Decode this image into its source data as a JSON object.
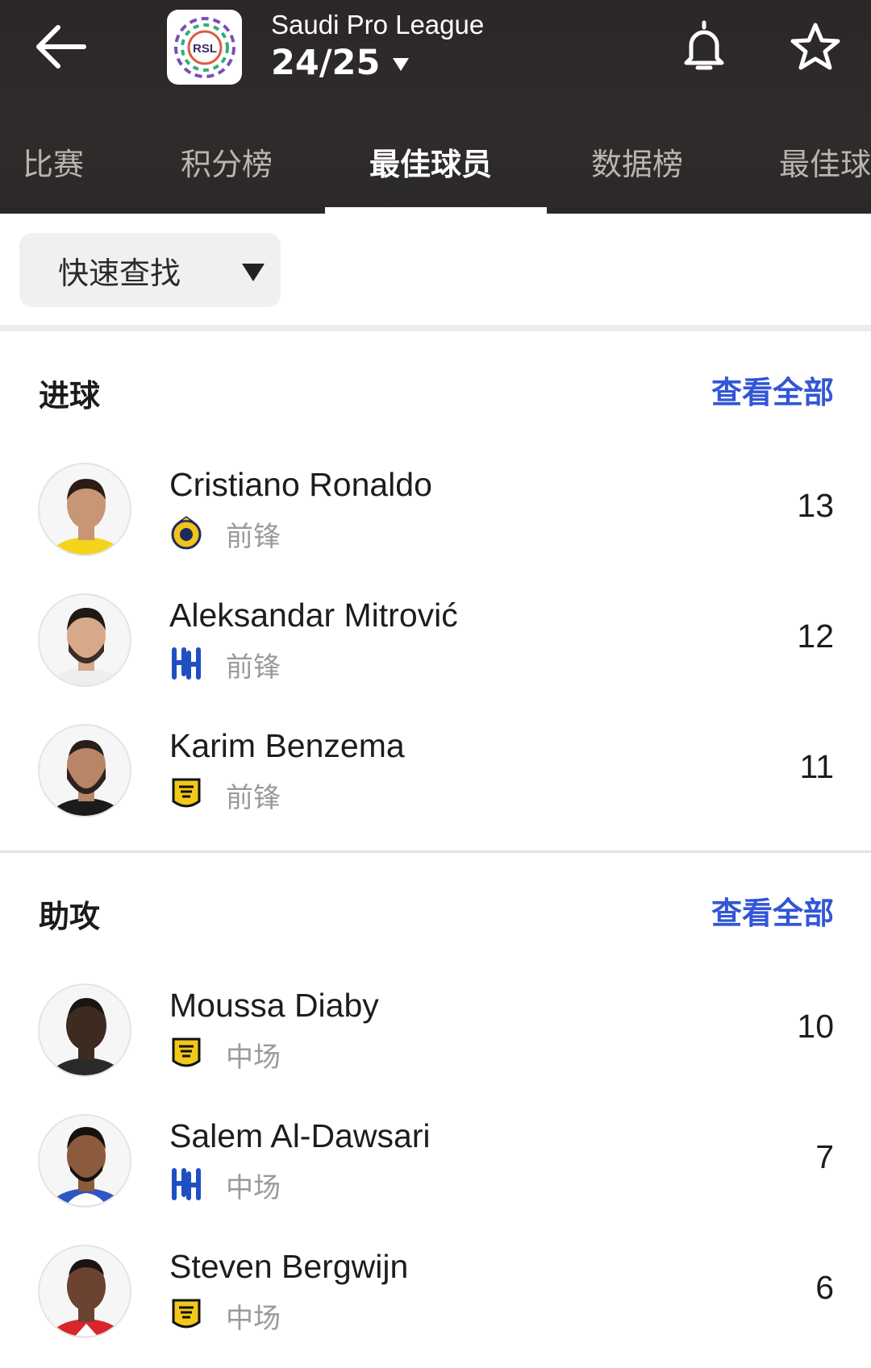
{
  "header": {
    "league_name": "Saudi Pro League",
    "season": "24/25",
    "logo_text": "RSL"
  },
  "tabs": [
    "比赛",
    "积分榜",
    "最佳球员",
    "数据榜",
    "最佳球"
  ],
  "active_tab": "最佳球员",
  "filter": {
    "quick_find_label": "快速查找"
  },
  "sections": [
    {
      "title": "进球",
      "view_all": "查看全部",
      "players": [
        {
          "name": "Cristiano Ronaldo",
          "position": "前锋",
          "value": "13",
          "club_icon": "al-nassr-badge-icon",
          "skin": "#c89674",
          "hair": "#2a1d15",
          "shirt": "#f3d31c"
        },
        {
          "name": "Aleksandar Mitrović",
          "position": "前锋",
          "value": "12",
          "club_icon": "al-hilal-badge-icon",
          "skin": "#d7a98a",
          "hair": "#1e1915",
          "shirt": "#eeeeee"
        },
        {
          "name": "Karim Benzema",
          "position": "前锋",
          "value": "11",
          "club_icon": "al-ittihad-badge-icon",
          "skin": "#b88567",
          "hair": "#262019",
          "shirt": "#1b1b1b"
        }
      ]
    },
    {
      "title": "助攻",
      "view_all": "查看全部",
      "players": [
        {
          "name": "Moussa Diaby",
          "position": "中场",
          "value": "10",
          "club_icon": "al-ittihad-badge-icon",
          "skin": "#3d2a20",
          "hair": "#1c1410",
          "shirt": "#2a2a2a"
        },
        {
          "name": "Salem Al-Dawsari",
          "position": "中场",
          "value": "7",
          "club_icon": "al-hilal-badge-icon",
          "skin": "#8c5a3c",
          "hair": "#15110e",
          "shirt": "#2f56c2"
        },
        {
          "name": "Steven Bergwijn",
          "position": "中场",
          "value": "6",
          "club_icon": "al-ittihad-badge-icon",
          "skin": "#6b4330",
          "hair": "#1a1310",
          "shirt": "#d8262c"
        }
      ]
    }
  ],
  "colors": {
    "header_bg": "#2c2a29",
    "link": "#3256d6",
    "muted": "#9a9a9a"
  }
}
